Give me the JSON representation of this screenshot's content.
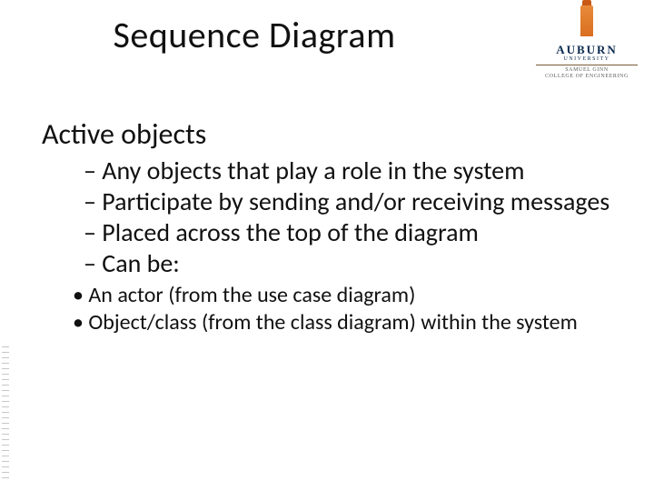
{
  "title": "Sequence Diagram",
  "logo": {
    "word": "AUBURN",
    "university": "UNIVERSITY",
    "college_l1": "SAMUEL GINN",
    "college_l2": "COLLEGE OF ENGINEERING"
  },
  "heading": "Active objects",
  "bullets": {
    "b1": "Any objects that play a role in the system",
    "b2": "Participate by sending and/or receiving messages",
    "b3": "Placed across the top of the diagram",
    "b4": "Can be:"
  },
  "subbullets": {
    "s1": "An actor (from the use case diagram)",
    "s2": "Object/class (from the class diagram) within the system"
  }
}
